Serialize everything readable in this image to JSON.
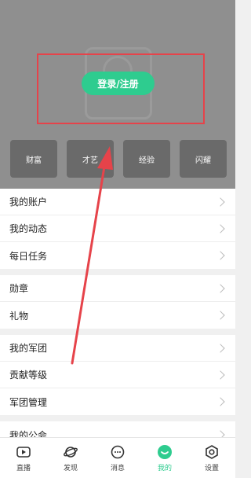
{
  "header": {
    "login_label": "登录/注册"
  },
  "tiles": [
    {
      "label": "财富"
    },
    {
      "label": "才艺"
    },
    {
      "label": "经验"
    },
    {
      "label": "闪耀"
    }
  ],
  "section1": [
    {
      "label": "我的账户"
    },
    {
      "label": "我的动态"
    },
    {
      "label": "每日任务"
    }
  ],
  "section2": [
    {
      "label": "勋章"
    },
    {
      "label": "礼物"
    }
  ],
  "section3": [
    {
      "label": "我的军团"
    },
    {
      "label": "贡献等级"
    },
    {
      "label": "军团管理"
    }
  ],
  "section4": [
    {
      "label": "我的公会"
    }
  ],
  "tabbar": [
    {
      "label": "直播",
      "icon": "video-icon"
    },
    {
      "label": "发现",
      "icon": "planet-icon"
    },
    {
      "label": "消息",
      "icon": "chat-icon"
    },
    {
      "label": "我的",
      "icon": "smile-icon",
      "active": true
    },
    {
      "label": "设置",
      "icon": "hexagon-settings-icon"
    }
  ],
  "colors": {
    "accent": "#2ecc8f",
    "annotation": "#e6434a",
    "header_bg": "#8f8f8f"
  }
}
